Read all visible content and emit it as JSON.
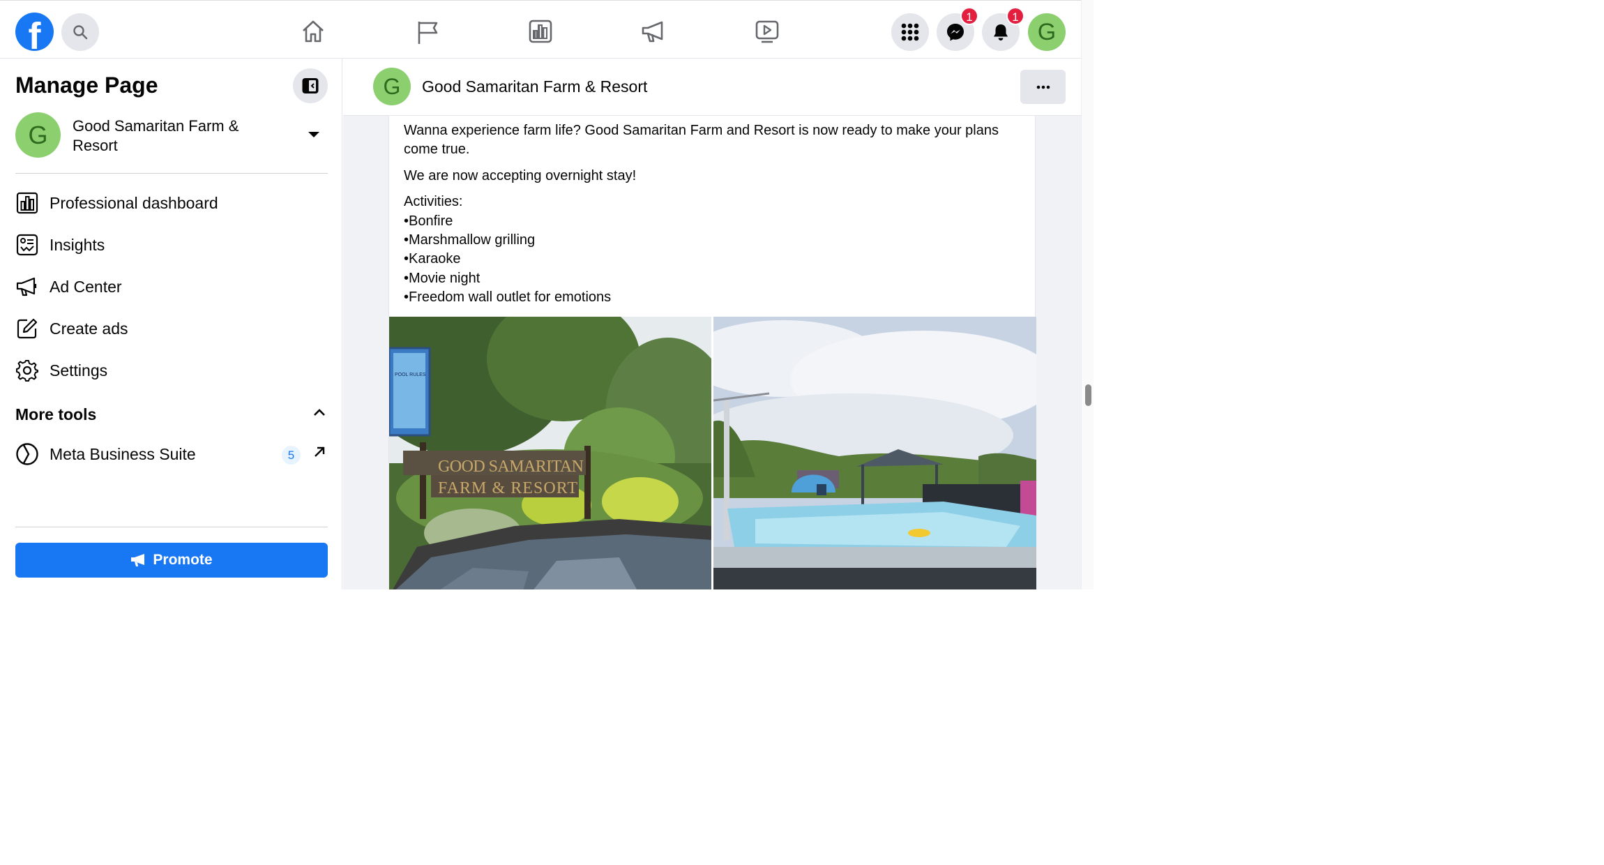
{
  "topbar": {
    "logo_letter": "f",
    "nav_icons": [
      "home-icon",
      "flag-icon",
      "dashboard-icon",
      "megaphone-icon",
      "video-icon"
    ],
    "messenger_badge": "1",
    "notifications_badge": "1",
    "avatar_letter": "G"
  },
  "sidebar": {
    "title": "Manage Page",
    "page": {
      "avatar_letter": "G",
      "name": "Good Samaritan Farm & Resort"
    },
    "items": [
      {
        "icon": "dashboard-icon",
        "label": "Professional dashboard"
      },
      {
        "icon": "insights-icon",
        "label": "Insights"
      },
      {
        "icon": "megaphone-icon",
        "label": "Ad Center"
      },
      {
        "icon": "edit-icon",
        "label": "Create ads"
      },
      {
        "icon": "gear-icon",
        "label": "Settings"
      }
    ],
    "more_tools": {
      "title": "More tools",
      "items": [
        {
          "icon": "meta-icon",
          "label": "Meta Business Suite",
          "count": "5"
        }
      ]
    },
    "promote_label": "Promote"
  },
  "post": {
    "header_avatar_letter": "G",
    "header_name": "Good Samaritan Farm & Resort",
    "intro": "Wanna experience farm life? Good Samaritan Farm and Resort is now ready to make your plans come true.",
    "line2": "We are now accepting overnight stay!",
    "activities_title": "Activities:",
    "activities": [
      "•Bonfire",
      "•Marshmallow grilling",
      "•Karaoke",
      "•Movie night",
      "•Freedom wall outlet for emotions"
    ],
    "photo1_sign": "GOOD SAMARITAN FARM & RESORT",
    "photo1_board": "POOL RULES"
  },
  "colors": {
    "brand": "#1877f2",
    "badge": "#e41e3f",
    "avatar": "#8ccf6f"
  }
}
